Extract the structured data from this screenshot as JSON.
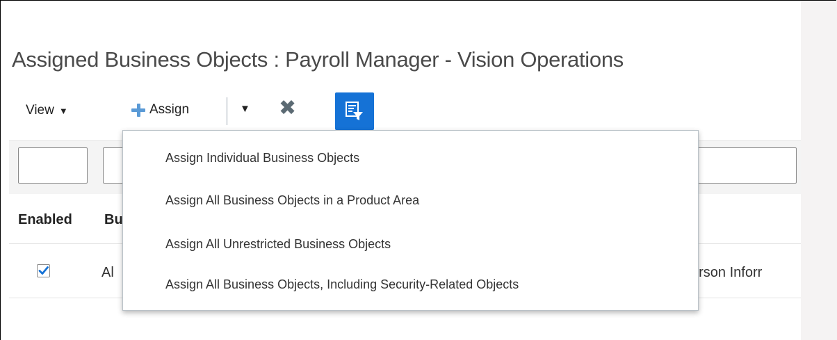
{
  "page": {
    "title": "Assigned Business Objects : Payroll Manager - Vision Operations"
  },
  "toolbar": {
    "view_label": "View",
    "assign_label": "Assign",
    "caret": "▼"
  },
  "table": {
    "headers": [
      "Enabled",
      "Bu"
    ],
    "rows": [
      {
        "enabled": true,
        "col2": "Al",
        "col3": "erson Inforr"
      }
    ]
  },
  "assign_menu": {
    "items": [
      "Assign Individual Business Objects",
      "Assign All Business Objects in a Product Area",
      "Assign All Unrestricted Business Objects",
      "Assign All Business Objects, Including Security-Related Objects"
    ]
  },
  "colors": {
    "accent": "#1572d6",
    "plus": "#5a9ad6",
    "title": "#4a4a4a"
  },
  "icons": [
    "chevron-down-icon",
    "plus-icon",
    "close-icon",
    "query-by-example-icon",
    "checkmark-icon"
  ]
}
